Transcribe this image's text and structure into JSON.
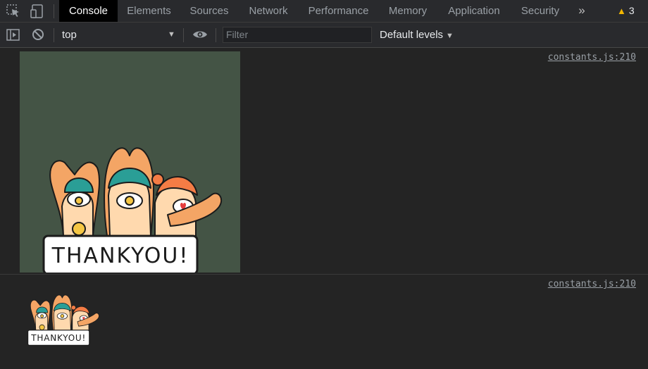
{
  "tabs": [
    {
      "label": "Console",
      "active": true
    },
    {
      "label": "Elements"
    },
    {
      "label": "Sources"
    },
    {
      "label": "Network"
    },
    {
      "label": "Performance"
    },
    {
      "label": "Memory"
    },
    {
      "label": "Application"
    },
    {
      "label": "Security"
    }
  ],
  "more_tabs_glyph": "»",
  "warnings": {
    "icon": "warning-triangle-icon",
    "count": "3"
  },
  "toolbar": {
    "context": "top",
    "filter_placeholder": "Filter",
    "levels": "Default levels"
  },
  "messages": [
    {
      "source": "constants.js:210",
      "image_banner": "THANKYOU!"
    },
    {
      "source": "constants.js:210",
      "image_banner": "THANKYOU!"
    }
  ],
  "colors": {
    "accent_warning": "#f2b600",
    "image_background": "#445445",
    "skin": "#fbc58a",
    "hair_teal": "#2a9e96",
    "hair_orange": "#f47c45"
  }
}
